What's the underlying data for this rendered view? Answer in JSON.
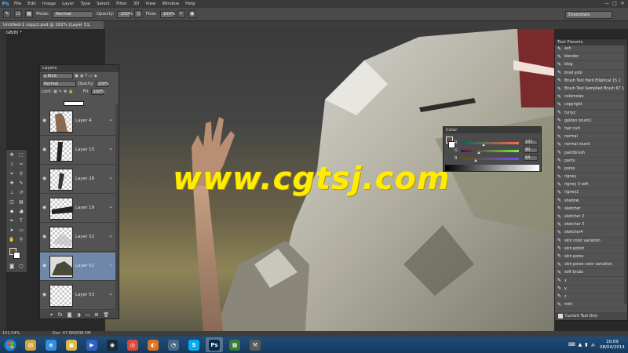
{
  "menubar": {
    "logo": "Ps",
    "items": [
      "File",
      "Edit",
      "Image",
      "Layer",
      "Type",
      "Select",
      "Filter",
      "3D",
      "View",
      "Window",
      "Help"
    ],
    "minimize": "—",
    "maximize": "□",
    "close": "✕"
  },
  "options": {
    "mode_label": "Mode:",
    "mode_value": "Normal",
    "opacity_label": "Opacity:",
    "opacity_value": "100%",
    "flow_label": "Flow:",
    "flow_value": "100%",
    "brush_size": "15",
    "workspace": "Essentials"
  },
  "doc_tab": {
    "title": "Untitled-1 copy2.psd @ 102% (Layer 51, RGB/8) *"
  },
  "layers_panel": {
    "title": "Layers",
    "kind_filter": "ρ Kind",
    "blend_mode": "Normal",
    "opacity_label": "Opacity:",
    "opacity_value": "100%",
    "lock_label": "Lock:",
    "fill_label": "Fill:",
    "fill_value": "100%",
    "layers": [
      {
        "name": "Layer 4",
        "selected": false
      },
      {
        "name": "Layer 15",
        "selected": false
      },
      {
        "name": "Layer 28",
        "selected": false
      },
      {
        "name": "Layer 19",
        "selected": false
      },
      {
        "name": "Layer 52",
        "selected": false
      },
      {
        "name": "Layer 51",
        "selected": true
      },
      {
        "name": "Layer 53",
        "selected": false
      }
    ],
    "footer_icons": [
      "⚭",
      "fx",
      "◙",
      "◑",
      "▭",
      "⊞",
      "🗑"
    ]
  },
  "color_panel": {
    "title": "Color",
    "channels": [
      {
        "letter": "R",
        "value": "101",
        "fraction": 0.396,
        "gradient": "linear-gradient(90deg,#006b4d,#ff6b4d)"
      },
      {
        "letter": "G",
        "value": "80",
        "fraction": 0.314,
        "gradient": "linear-gradient(90deg,#650040,#65ff40)"
      },
      {
        "letter": "B",
        "value": "64",
        "fraction": 0.251,
        "gradient": "linear-gradient(90deg,#655000,#6550ff)"
      }
    ],
    "fg_color": "#655040"
  },
  "presets_panel": {
    "title": "Tool Presets",
    "items": [
      "ash",
      "blender",
      "blog",
      "brad yolo",
      "Brush Tool Hard Elliptical 15 1",
      "Brush Tool Samplled Brush 67 1",
      "colornoise",
      "copyright",
      "furryz",
      "golden brush1",
      "hair curl",
      "normal",
      "normal round",
      "paintbrush",
      "pants",
      "pores",
      "rigney",
      "rigney 3 soft",
      "rigney2",
      "shadow",
      "sketcher",
      "sketcher 2",
      "sketcher 3",
      "sketcher4",
      "skin color variation",
      "skin polish",
      "skin pores",
      "skin pores color variation",
      "soft brubs",
      "x",
      "y",
      "z",
      "mini"
    ],
    "current_only": "Current Tool Only"
  },
  "status": {
    "zoom": "101.54%",
    "doc": "Doc: 47.6M/838.5M"
  },
  "watermark": "www.cgtsj.com",
  "taskbar": {
    "apps": [
      {
        "name": "folder",
        "glyph": "▤",
        "color": "#d4a23c",
        "active": false
      },
      {
        "name": "internet-explorer",
        "glyph": "e",
        "color": "#2f8fe0",
        "active": false
      },
      {
        "name": "file-explorer",
        "glyph": "▣",
        "color": "#e0b64c",
        "active": false
      },
      {
        "name": "media-player",
        "glyph": "▶",
        "color": "#3060c0",
        "active": false
      },
      {
        "name": "steam",
        "glyph": "◉",
        "color": "#1b2838",
        "active": false
      },
      {
        "name": "chrome",
        "glyph": "◎",
        "color": "#d94a3a",
        "active": false
      },
      {
        "name": "firefox",
        "glyph": "◐",
        "color": "#e07020",
        "active": false
      },
      {
        "name": "settings",
        "glyph": "◔",
        "color": "#4a6a8a",
        "active": false
      },
      {
        "name": "skype",
        "glyph": "S",
        "color": "#00aff0",
        "active": false
      },
      {
        "name": "photoshop",
        "glyph": "Ps",
        "color": "#0c2a48",
        "active": true
      },
      {
        "name": "monitor",
        "glyph": "▦",
        "color": "#3a7a3a",
        "active": false
      },
      {
        "name": "tool",
        "glyph": "⚒",
        "color": "#5a5a5a",
        "active": false
      }
    ],
    "time": "10:09",
    "date": "08/04/2014"
  }
}
